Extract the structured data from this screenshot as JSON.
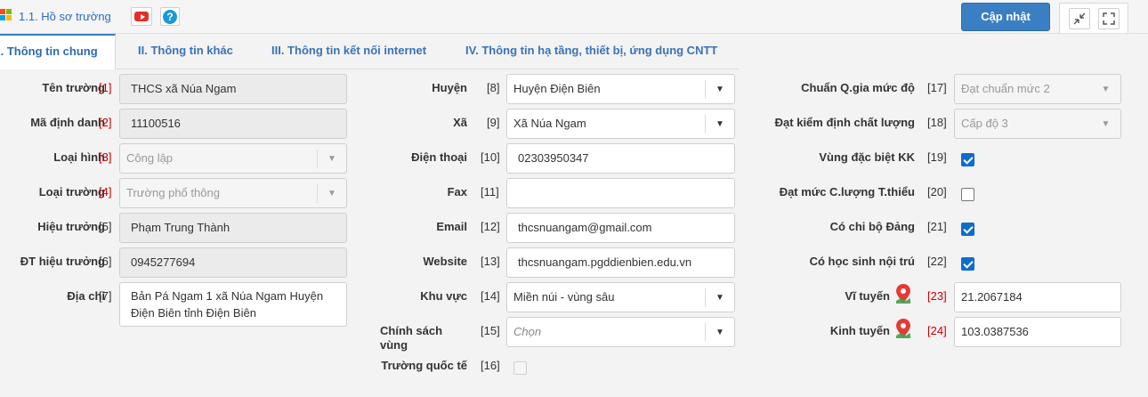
{
  "header": {
    "title": "1.1. Hồ sơ trường",
    "help_label": "?",
    "update_button": "Cập nhật",
    "colors": {
      "accent": "#3a7ec4",
      "youtube": "#e52d27",
      "required": "#cc0000"
    }
  },
  "tabs": [
    {
      "label": "I. Thông tin chung",
      "active": true
    },
    {
      "label": "II. Thông tin khác",
      "active": false
    },
    {
      "label": "III. Thông tin kết nối internet",
      "active": false
    },
    {
      "label": "IV. Thông tin hạ tầng, thiết bị, ứng dụng CNTT",
      "active": false
    }
  ],
  "col1": [
    {
      "label": "Tên trường",
      "num": "[1]",
      "value": "THCS xã Núa Ngam"
    },
    {
      "label": "Mã định danh",
      "num": "[2]",
      "value": "11100516"
    },
    {
      "label": "Loại hình",
      "num": "[3]",
      "value": "Công lập"
    },
    {
      "label": "Loại trường",
      "num": "[4]",
      "value": "Trường phổ thông"
    },
    {
      "label": "Hiệu trưởng",
      "num": "[5]",
      "value": "Phạm Trung Thành"
    },
    {
      "label": "ĐT hiệu trưởng",
      "num": "[6]",
      "value": "0945277694"
    },
    {
      "label": "Địa chỉ",
      "num": "[7]",
      "value": "Bản Pá Ngam 1 xã Núa Ngam Huyện Điện Biên tỉnh Điện Biên"
    }
  ],
  "col2": [
    {
      "label": "Huyện",
      "num": "[8]",
      "value": "Huyện Điện Biên"
    },
    {
      "label": "Xã",
      "num": "[9]",
      "value": "Xã Núa Ngam"
    },
    {
      "label": "Điện thoại",
      "num": "[10]",
      "value": "02303950347"
    },
    {
      "label": "Fax",
      "num": "[11]",
      "value": ""
    },
    {
      "label": "Email",
      "num": "[12]",
      "value": "thcsnuangam@gmail.com"
    },
    {
      "label": "Website",
      "num": "[13]",
      "value": "thcsnuangam.pgddienbien.edu.vn"
    },
    {
      "label": "Khu vực",
      "num": "[14]",
      "value": "Miền núi - vùng sâu"
    },
    {
      "label": "Chính sách vùng",
      "num": "[15]",
      "placeholder": "Chọn"
    },
    {
      "label": "Trường quốc tế",
      "num": "[16]",
      "checked": false
    }
  ],
  "col3": [
    {
      "label": "Chuẩn Q.gia mức độ",
      "num": "[17]",
      "value": "Đạt chuẩn mức 2"
    },
    {
      "label": "Đạt kiểm định chất lượng",
      "num": "[18]",
      "value": "Cấp độ 3"
    },
    {
      "label": "Vùng đặc biệt KK",
      "num": "[19]",
      "checked": true
    },
    {
      "label": "Đạt mức C.lượng T.thiểu",
      "num": "[20]",
      "checked": false
    },
    {
      "label": "Có chi bộ Đảng",
      "num": "[21]",
      "checked": true
    },
    {
      "label": "Có học sinh nội trú",
      "num": "[22]",
      "checked": true
    },
    {
      "label": "Vĩ tuyến",
      "num": "[23]",
      "value": "21.2067184"
    },
    {
      "label": "Kinh tuyến",
      "num": "[24]",
      "value": "103.0387536"
    }
  ]
}
